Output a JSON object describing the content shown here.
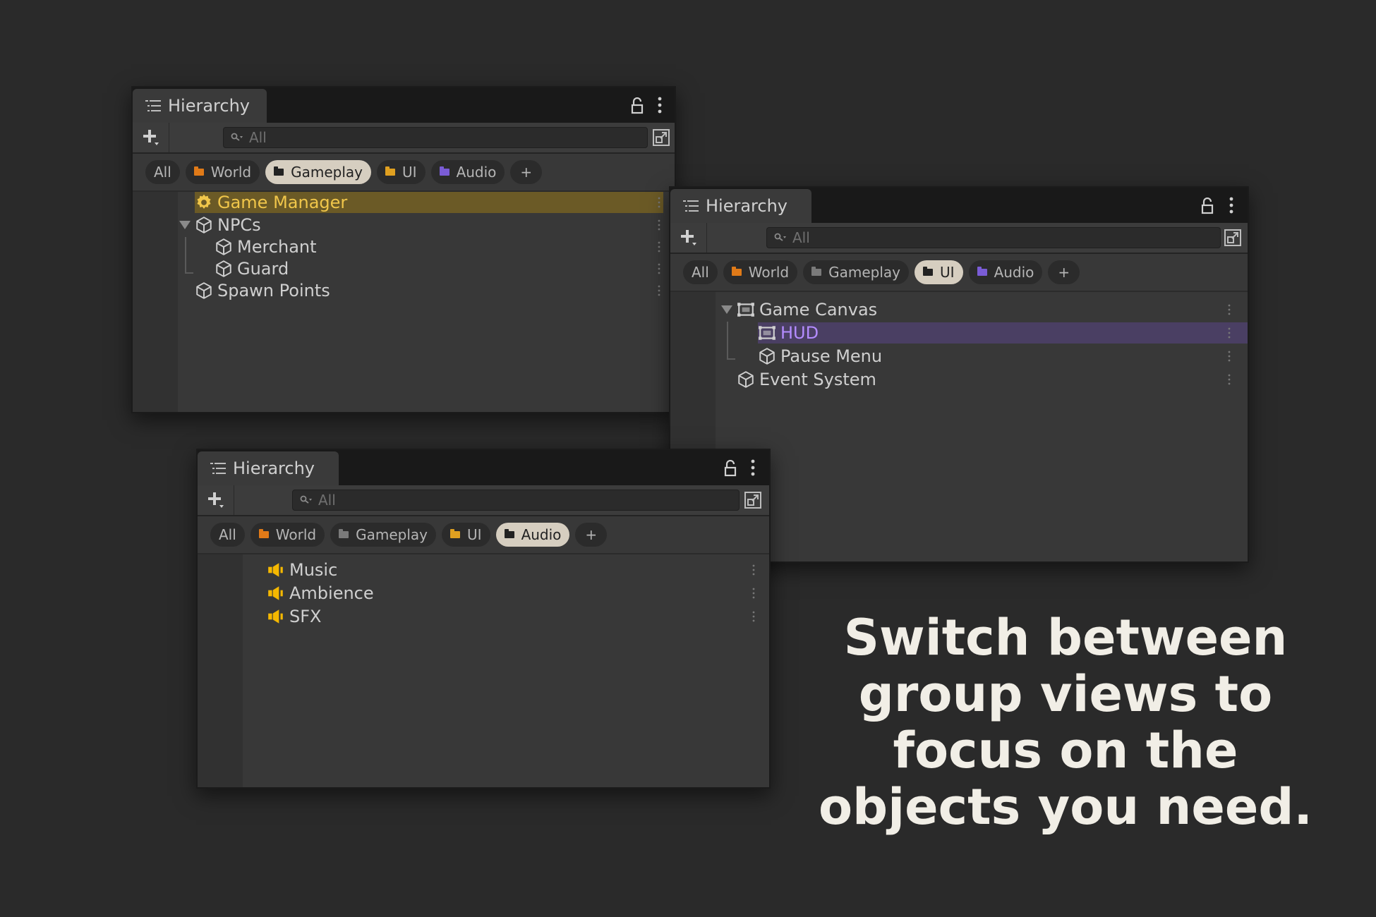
{
  "colors": {
    "background": "#2a2a2a",
    "gameplay_highlight": "#6b5a26",
    "gameplay_text": "#f0c64a",
    "ui_highlight": "#4a3f63",
    "ui_text": "#b48cff",
    "audio_icon": "#f5b800",
    "world_folder": "#e07a18",
    "gameplay_folder": "#7a7a7a",
    "ui_folder": "#e0a020",
    "audio_folder": "#7a5cd6"
  },
  "panels": [
    {
      "tab_label": "Hierarchy",
      "search_placeholder": "All",
      "chips": [
        "All",
        "World",
        "Gameplay",
        "UI",
        "Audio",
        "+"
      ],
      "active_chip": "Gameplay",
      "rows": [
        {
          "label": "Game Manager",
          "icon": "gear-icon",
          "selected": true
        },
        {
          "label": "NPCs",
          "icon": "cube-icon",
          "expanded": true
        },
        {
          "label": "Merchant",
          "icon": "cube-icon"
        },
        {
          "label": "Guard",
          "icon": "cube-icon"
        },
        {
          "label": "Spawn Points",
          "icon": "cube-icon"
        }
      ]
    },
    {
      "tab_label": "Hierarchy",
      "search_placeholder": "All",
      "chips": [
        "All",
        "World",
        "Gameplay",
        "UI",
        "Audio",
        "+"
      ],
      "active_chip": "UI",
      "rows": [
        {
          "label": "Game Canvas",
          "icon": "canvas-icon",
          "expanded": true
        },
        {
          "label": "HUD",
          "icon": "canvas-icon",
          "selected": true
        },
        {
          "label": "Pause Menu",
          "icon": "cube-icon"
        },
        {
          "label": "Event System",
          "icon": "cube-icon"
        }
      ]
    },
    {
      "tab_label": "Hierarchy",
      "search_placeholder": "All",
      "chips": [
        "All",
        "World",
        "Gameplay",
        "UI",
        "Audio",
        "+"
      ],
      "active_chip": "Audio",
      "rows": [
        {
          "label": "Music",
          "icon": "speaker-icon"
        },
        {
          "label": "Ambience",
          "icon": "speaker-icon"
        },
        {
          "label": "SFX",
          "icon": "speaker-icon"
        }
      ]
    }
  ],
  "headline": "Switch between group views to focus on the objects you need."
}
